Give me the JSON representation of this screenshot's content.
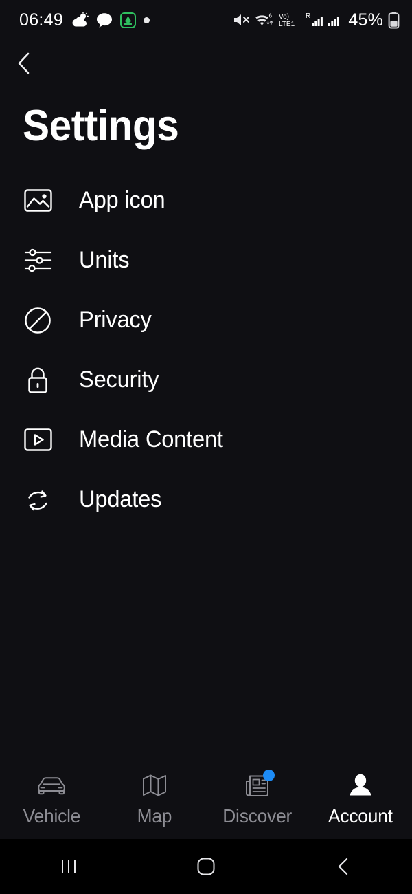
{
  "status_bar": {
    "time": "06:49",
    "battery_percent": "45%",
    "notification_icons": [
      "weather-partly-cloudy-icon",
      "chat-bubble-icon",
      "green-app-icon",
      "notification-dot-icon"
    ],
    "status_icons": [
      "mute-icon",
      "wifi-6-icon",
      "volte-icon",
      "roaming-signal-icon",
      "signal-bars-icon",
      "battery-icon"
    ],
    "wifi_generation": "6",
    "volte_label": "Vo)",
    "lte_label": "LTE1",
    "roaming_label": "R"
  },
  "header": {
    "back_icon": "chevron-left-icon",
    "title": "Settings"
  },
  "menu": {
    "items": [
      {
        "label": "App icon",
        "icon": "image-icon"
      },
      {
        "label": "Units",
        "icon": "sliders-icon"
      },
      {
        "label": "Privacy",
        "icon": "block-circle-slash-icon"
      },
      {
        "label": "Security",
        "icon": "lock-icon"
      },
      {
        "label": "Media Content",
        "icon": "video-play-icon"
      },
      {
        "label": "Updates",
        "icon": "refresh-sync-icon"
      }
    ]
  },
  "tab_bar": {
    "items": [
      {
        "label": "Vehicle",
        "icon": "car-icon",
        "active": false,
        "badge": false
      },
      {
        "label": "Map",
        "icon": "map-icon",
        "active": false,
        "badge": false
      },
      {
        "label": "Discover",
        "icon": "newspaper-icon",
        "active": false,
        "badge": true
      },
      {
        "label": "Account",
        "icon": "person-icon",
        "active": true,
        "badge": false
      }
    ]
  },
  "system_nav": {
    "recents_icon": "recents-icon",
    "home_icon": "home-icon",
    "back_icon": "back-chevron-icon"
  },
  "colors": {
    "background": "#0f0f13",
    "system_nav_background": "#000000",
    "text_primary": "#ffffff",
    "text_inactive": "#8d8d94",
    "badge_blue": "#1d8bf5"
  }
}
